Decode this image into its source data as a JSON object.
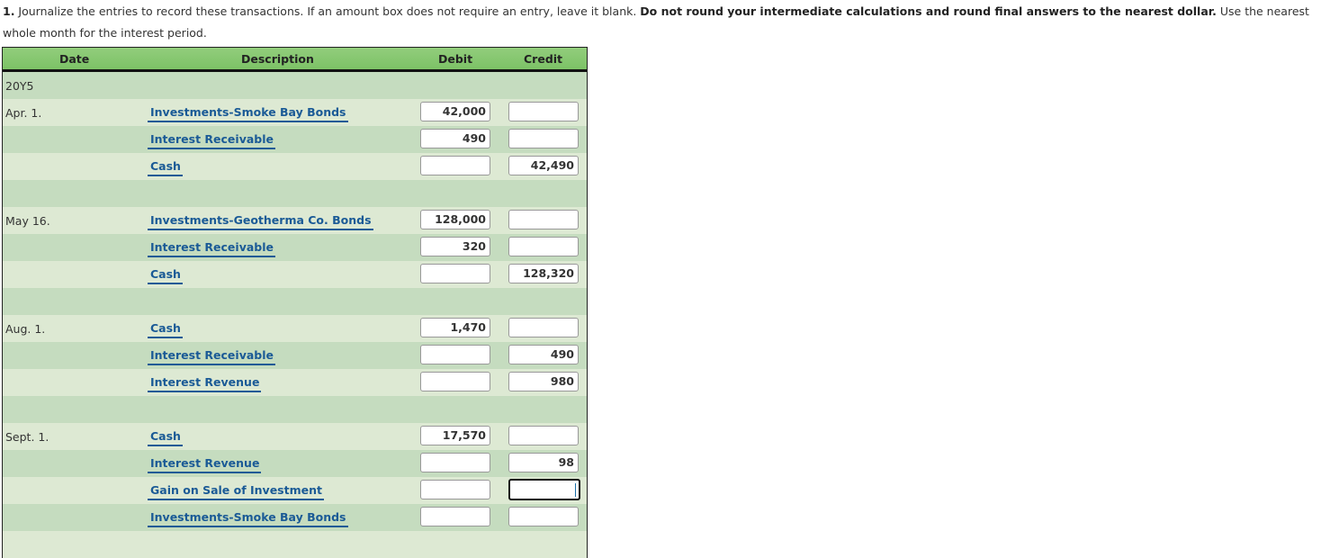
{
  "instructions": {
    "number": "1.",
    "text1": " Journalize the entries to record these transactions. If an amount box does not require an entry, leave it blank. ",
    "bold": "Do not round your intermediate calculations and round final answers to the nearest dollar.",
    "text2": " Use the nearest whole month for the interest period."
  },
  "journal": {
    "headers": {
      "date": "Date",
      "description": "Description",
      "debit": "Debit",
      "credit": "Credit"
    },
    "year": "20Y5",
    "rows": [
      {
        "date": "Apr. 1.",
        "account": "Investments-Smoke Bay Bonds",
        "debit": "42,000",
        "credit": ""
      },
      {
        "date": "",
        "account": "Interest Receivable",
        "debit": "490",
        "credit": ""
      },
      {
        "date": "",
        "account": "Cash",
        "debit": "",
        "credit": "42,490"
      },
      {
        "date": "May 16.",
        "account": "Investments-Geotherma Co. Bonds",
        "debit": "128,000",
        "credit": ""
      },
      {
        "date": "",
        "account": "Interest Receivable",
        "debit": "320",
        "credit": ""
      },
      {
        "date": "",
        "account": "Cash",
        "debit": "",
        "credit": "128,320"
      },
      {
        "date": "Aug. 1.",
        "account": "Cash",
        "debit": "1,470",
        "credit": ""
      },
      {
        "date": "",
        "account": "Interest Receivable",
        "debit": "",
        "credit": "490"
      },
      {
        "date": "",
        "account": "Interest Revenue",
        "debit": "",
        "credit": "980"
      },
      {
        "date": "Sept. 1.",
        "account": "Cash",
        "debit": "17,570",
        "credit": ""
      },
      {
        "date": "",
        "account": "Interest Revenue",
        "debit": "",
        "credit": "98"
      },
      {
        "date": "",
        "account": "Gain on Sale of Investment",
        "debit": "",
        "credit": ""
      },
      {
        "date": "",
        "account": "Investments-Smoke Bay Bonds",
        "debit": "",
        "credit": ""
      }
    ]
  }
}
